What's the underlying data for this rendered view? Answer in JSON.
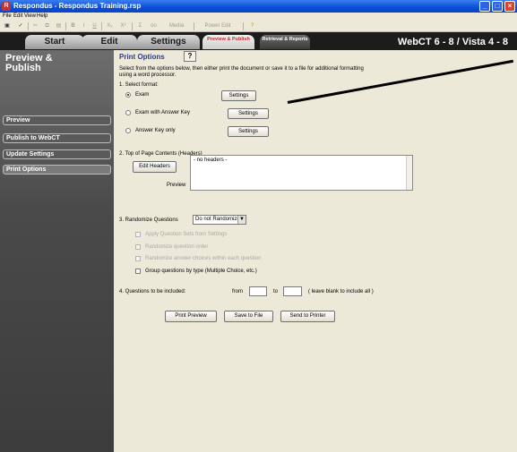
{
  "window": {
    "title": "Respondus - Respondus Training.rsp",
    "controls": {
      "minimize": "_",
      "maximize": "□",
      "close": "×"
    }
  },
  "menu": [
    "File",
    "Edit",
    "View",
    "Help"
  ],
  "toolbar": {
    "items": [
      "B",
      "I",
      "U",
      "X₂",
      "X²",
      "Σ",
      "oo",
      "Media",
      "Power Edit"
    ]
  },
  "nav": {
    "tabs": [
      {
        "label": "Start"
      },
      {
        "label": "Edit"
      },
      {
        "label": "Settings"
      },
      {
        "label": "Preview & Publish"
      },
      {
        "label": "Retrieval & Reports"
      }
    ],
    "brand": "WebCT 6 - 8 / Vista 4 - 8"
  },
  "sidebar": {
    "title_line1": "Preview &",
    "title_line2": "Publish",
    "items": [
      "Preview",
      "Publish to WebCT",
      "Update Settings",
      "Print Options"
    ]
  },
  "main": {
    "header": "Print Options",
    "help": "?",
    "intro_line1": "Select from the options below, then either print the document or save it to a file for additional formatting",
    "intro_line2": "using a word processor.",
    "section1": "1. Select format:",
    "formats": [
      {
        "label": "Exam",
        "selected": true
      },
      {
        "label": "Exam with Answer Key",
        "selected": false
      },
      {
        "label": "Answer Key only",
        "selected": false
      }
    ],
    "settings_label": "Settings",
    "section2": "2. Top of Page Contents (Headers)",
    "edit_headers": "Edit Headers",
    "preview_label": "Preview",
    "headers_preview": "- no headers -",
    "section3": "3. Randomize Questions",
    "randomize_value": "Do not Randomize",
    "randomize_options": [
      {
        "label": "Apply Question Sets from Settings",
        "enabled": false
      },
      {
        "label": "Randomize question order",
        "enabled": false
      },
      {
        "label": "Randomize answer choices within each question",
        "enabled": false
      },
      {
        "label": "Group questions by type (Multiple Choice, etc.)",
        "enabled": true
      }
    ],
    "section4": "4. Questions to be included:",
    "from_label": "from",
    "to_label": "to",
    "blank_note": "( leave blank to include all )",
    "from_value": "",
    "to_value": "",
    "actions": [
      "Print Preview",
      "Save to File",
      "Send to Printer"
    ]
  }
}
